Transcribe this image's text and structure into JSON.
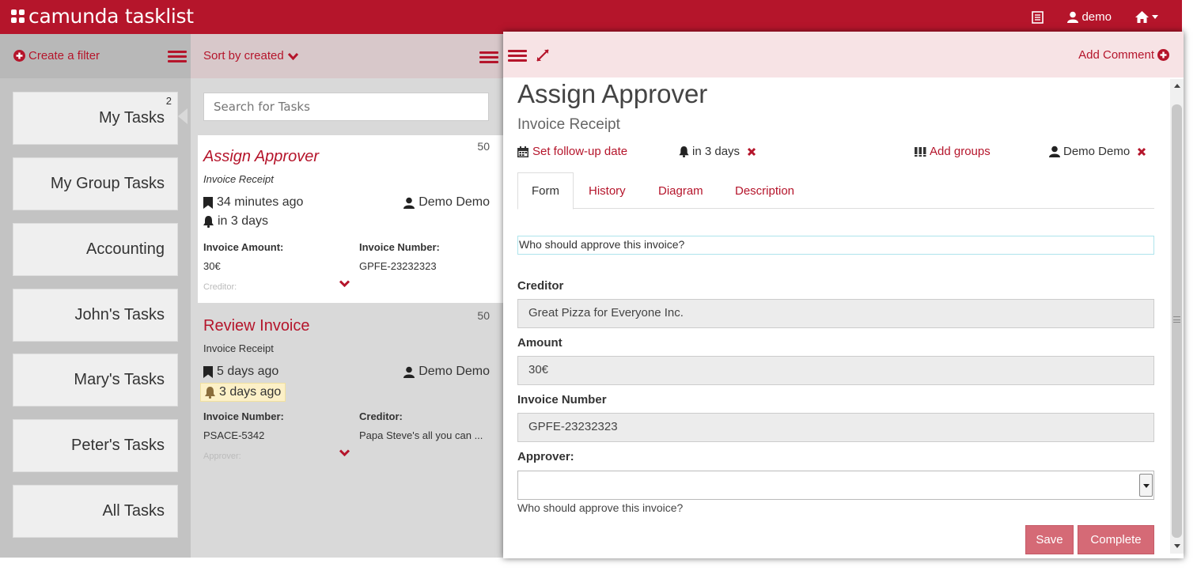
{
  "app": {
    "brand": "camunda tasklist"
  },
  "topnav": {
    "user": "demo"
  },
  "filters": {
    "create_label": "Create a filter",
    "items": [
      {
        "label": "My Tasks",
        "count": "2"
      },
      {
        "label": "My Group Tasks"
      },
      {
        "label": "Accounting"
      },
      {
        "label": "John's Tasks"
      },
      {
        "label": "Mary's Tasks"
      },
      {
        "label": "Peter's Tasks"
      },
      {
        "label": "All Tasks"
      }
    ]
  },
  "tasklist": {
    "sort_label": "Sort by created",
    "search_placeholder": "Search for Tasks",
    "tasks": [
      {
        "title": "Assign Approver",
        "process": "Invoice Receipt",
        "priority": "50",
        "created": "34 minutes ago",
        "due": "in 3 days",
        "assignee": "Demo Demo",
        "vars": [
          {
            "label": "Invoice Amount:",
            "value": "30€"
          },
          {
            "label": "Invoice Number:",
            "value": "GPFE-23232323"
          }
        ],
        "more_label": "Creditor:"
      },
      {
        "title": "Review Invoice",
        "process": "Invoice Receipt",
        "priority": "50",
        "created": "5 days ago",
        "due": "3 days ago",
        "assignee": "Demo Demo",
        "vars": [
          {
            "label": "Invoice Number:",
            "value": "PSACE-5342"
          },
          {
            "label": "Creditor:",
            "value": "Papa Steve's all you can ..."
          }
        ],
        "more_label": "Approver:"
      }
    ]
  },
  "detail": {
    "add_comment": "Add Comment",
    "title": "Assign Approver",
    "subtitle": "Invoice Receipt",
    "follow_up": "Set follow-up date",
    "due": "in 3 days",
    "add_groups": "Add groups",
    "assignee": "Demo Demo",
    "tabs": [
      "Form",
      "History",
      "Diagram",
      "Description"
    ],
    "form": {
      "help_top": "Who should approve this invoice?",
      "fields": [
        {
          "label": "Creditor",
          "value": "Great Pizza for Everyone Inc."
        },
        {
          "label": "Amount",
          "value": "30€"
        },
        {
          "label": "Invoice Number",
          "value": "GPFE-23232323"
        }
      ],
      "approver_label": "Approver:",
      "approver_help": "Who should approve this invoice?",
      "save": "Save",
      "complete": "Complete"
    }
  },
  "colors": {
    "brand": "#b5152b",
    "button": "#d56a76",
    "header_tint": "#f7e3e5"
  }
}
